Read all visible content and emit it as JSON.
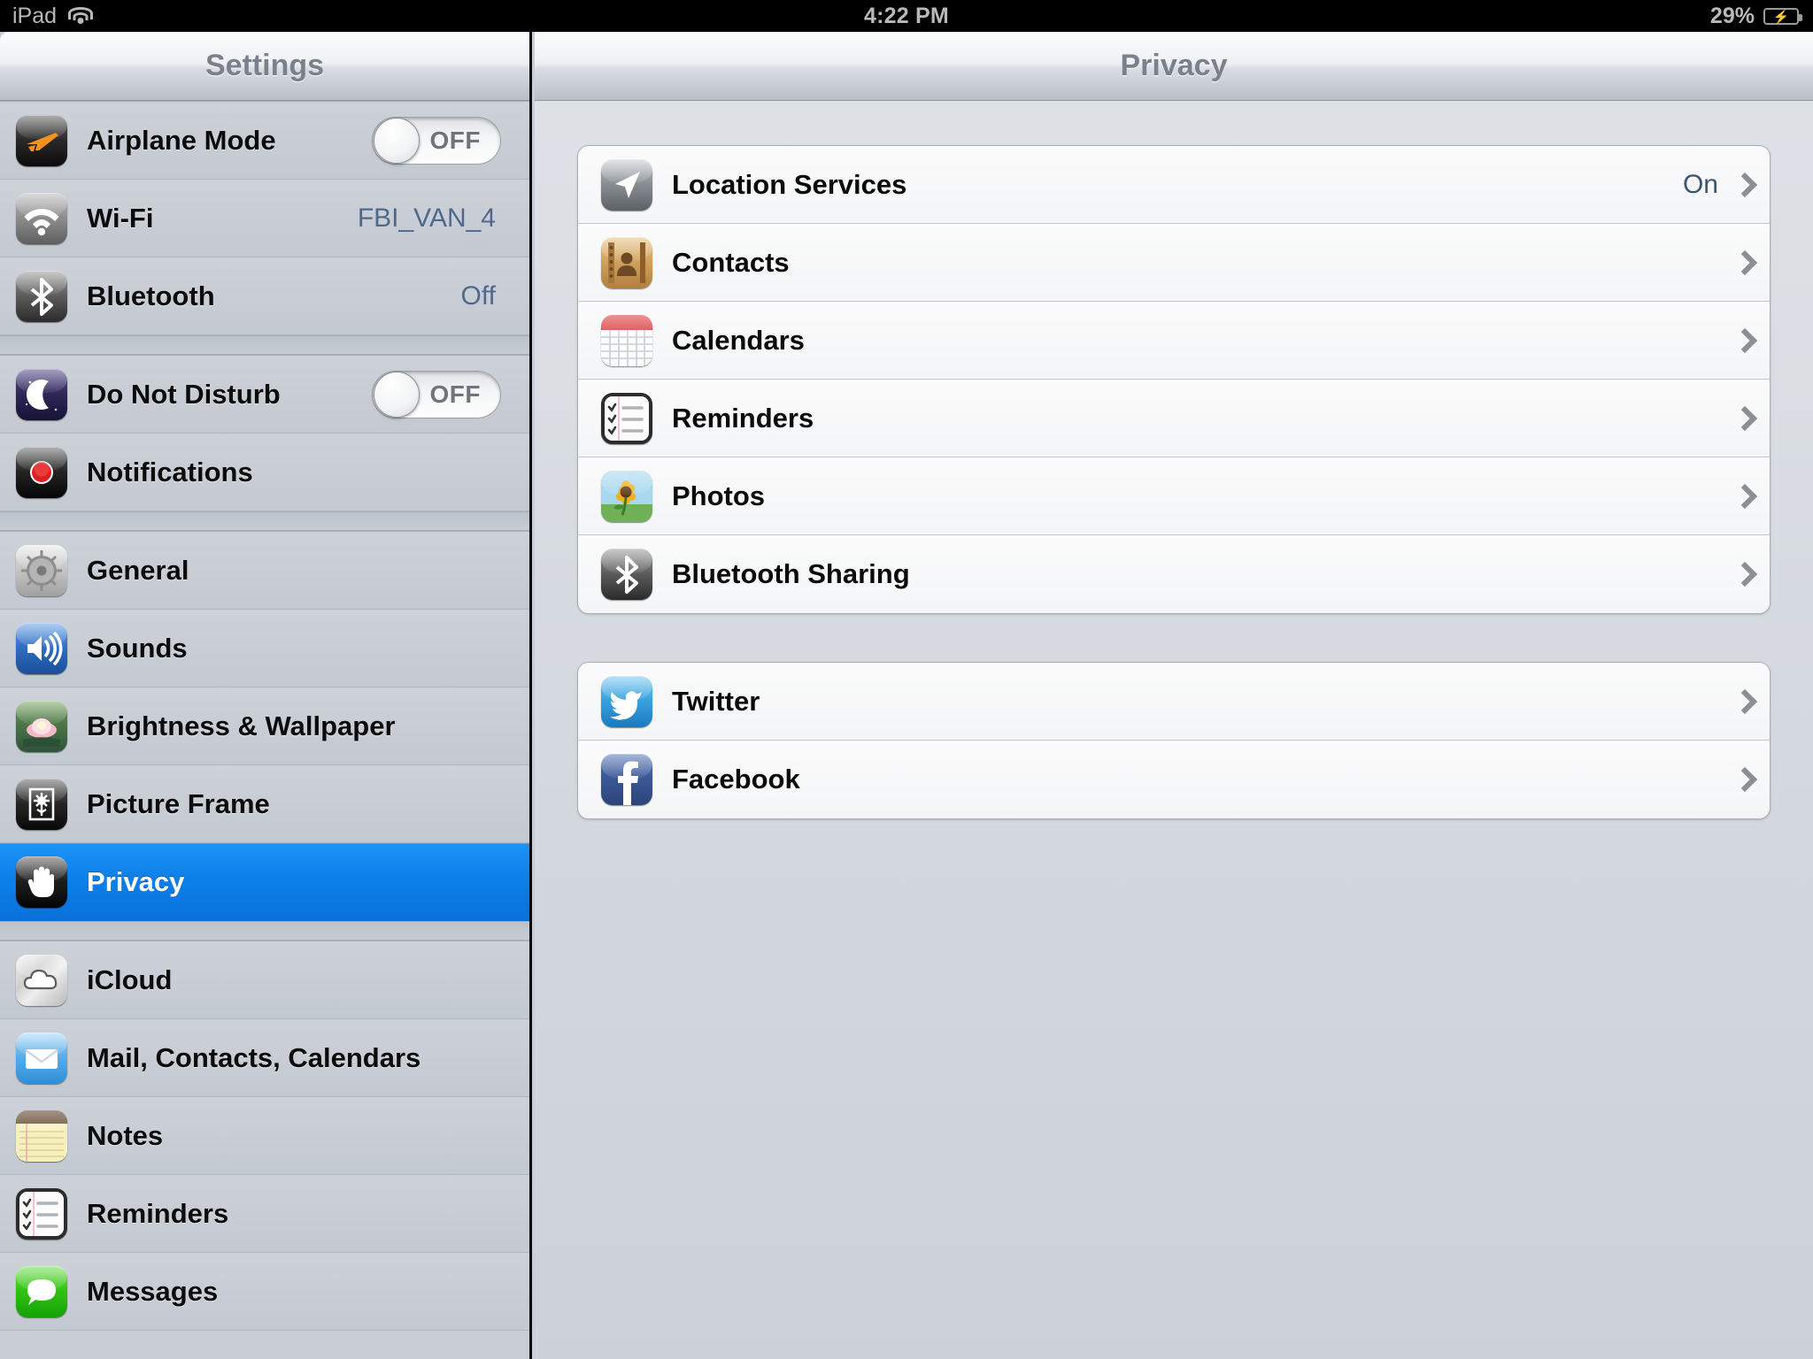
{
  "statusbar": {
    "device": "iPad",
    "wifi_icon": "wifi-icon",
    "time": "4:22 PM",
    "battery_percent": "29%",
    "battery_icon": "battery-charging-icon"
  },
  "sidebar": {
    "title": "Settings",
    "groups": [
      {
        "items": [
          {
            "label": "Airplane Mode",
            "icon": "airplane-icon",
            "control": "toggle",
            "toggle_label": "OFF",
            "toggle_state": "off"
          },
          {
            "label": "Wi-Fi",
            "icon": "wifi-icon",
            "value": "FBI_VAN_4"
          },
          {
            "label": "Bluetooth",
            "icon": "bluetooth-icon",
            "value": "Off"
          }
        ]
      },
      {
        "items": [
          {
            "label": "Do Not Disturb",
            "icon": "moon-icon",
            "control": "toggle",
            "toggle_label": "OFF",
            "toggle_state": "off"
          },
          {
            "label": "Notifications",
            "icon": "notifications-icon"
          }
        ]
      },
      {
        "items": [
          {
            "label": "General",
            "icon": "gear-icon"
          },
          {
            "label": "Sounds",
            "icon": "speaker-icon"
          },
          {
            "label": "Brightness & Wallpaper",
            "icon": "flower-wallpaper-icon"
          },
          {
            "label": "Picture Frame",
            "icon": "picture-frame-icon"
          },
          {
            "label": "Privacy",
            "icon": "hand-icon",
            "selected": true
          }
        ]
      },
      {
        "items": [
          {
            "label": "iCloud",
            "icon": "cloud-icon"
          },
          {
            "label": "Mail, Contacts, Calendars",
            "icon": "mail-icon"
          },
          {
            "label": "Notes",
            "icon": "notes-icon"
          },
          {
            "label": "Reminders",
            "icon": "reminders-icon"
          },
          {
            "label": "Messages",
            "icon": "messages-icon"
          }
        ]
      }
    ]
  },
  "detail": {
    "title": "Privacy",
    "groups": [
      {
        "rows": [
          {
            "label": "Location Services",
            "icon": "location-arrow-icon",
            "value": "On",
            "chevron": "chevron-right-icon"
          },
          {
            "label": "Contacts",
            "icon": "contacts-book-icon",
            "chevron": "chevron-right-icon"
          },
          {
            "label": "Calendars",
            "icon": "calendar-icon",
            "chevron": "chevron-right-icon"
          },
          {
            "label": "Reminders",
            "icon": "reminders-icon",
            "chevron": "chevron-right-icon"
          },
          {
            "label": "Photos",
            "icon": "photos-sunflower-icon",
            "chevron": "chevron-right-icon"
          },
          {
            "label": "Bluetooth Sharing",
            "icon": "bluetooth-icon",
            "chevron": "chevron-right-icon"
          }
        ]
      },
      {
        "rows": [
          {
            "label": "Twitter",
            "icon": "twitter-icon",
            "chevron": "chevron-right-icon"
          },
          {
            "label": "Facebook",
            "icon": "facebook-icon",
            "chevron": "chevron-right-icon"
          }
        ]
      }
    ]
  },
  "colors": {
    "selection_blue": "#0d7ee8",
    "value_blue": "#50688a",
    "title_gray": "#7b818c",
    "sidebar_bg": "#c9ced6",
    "detail_bg": "#d3d8de"
  }
}
